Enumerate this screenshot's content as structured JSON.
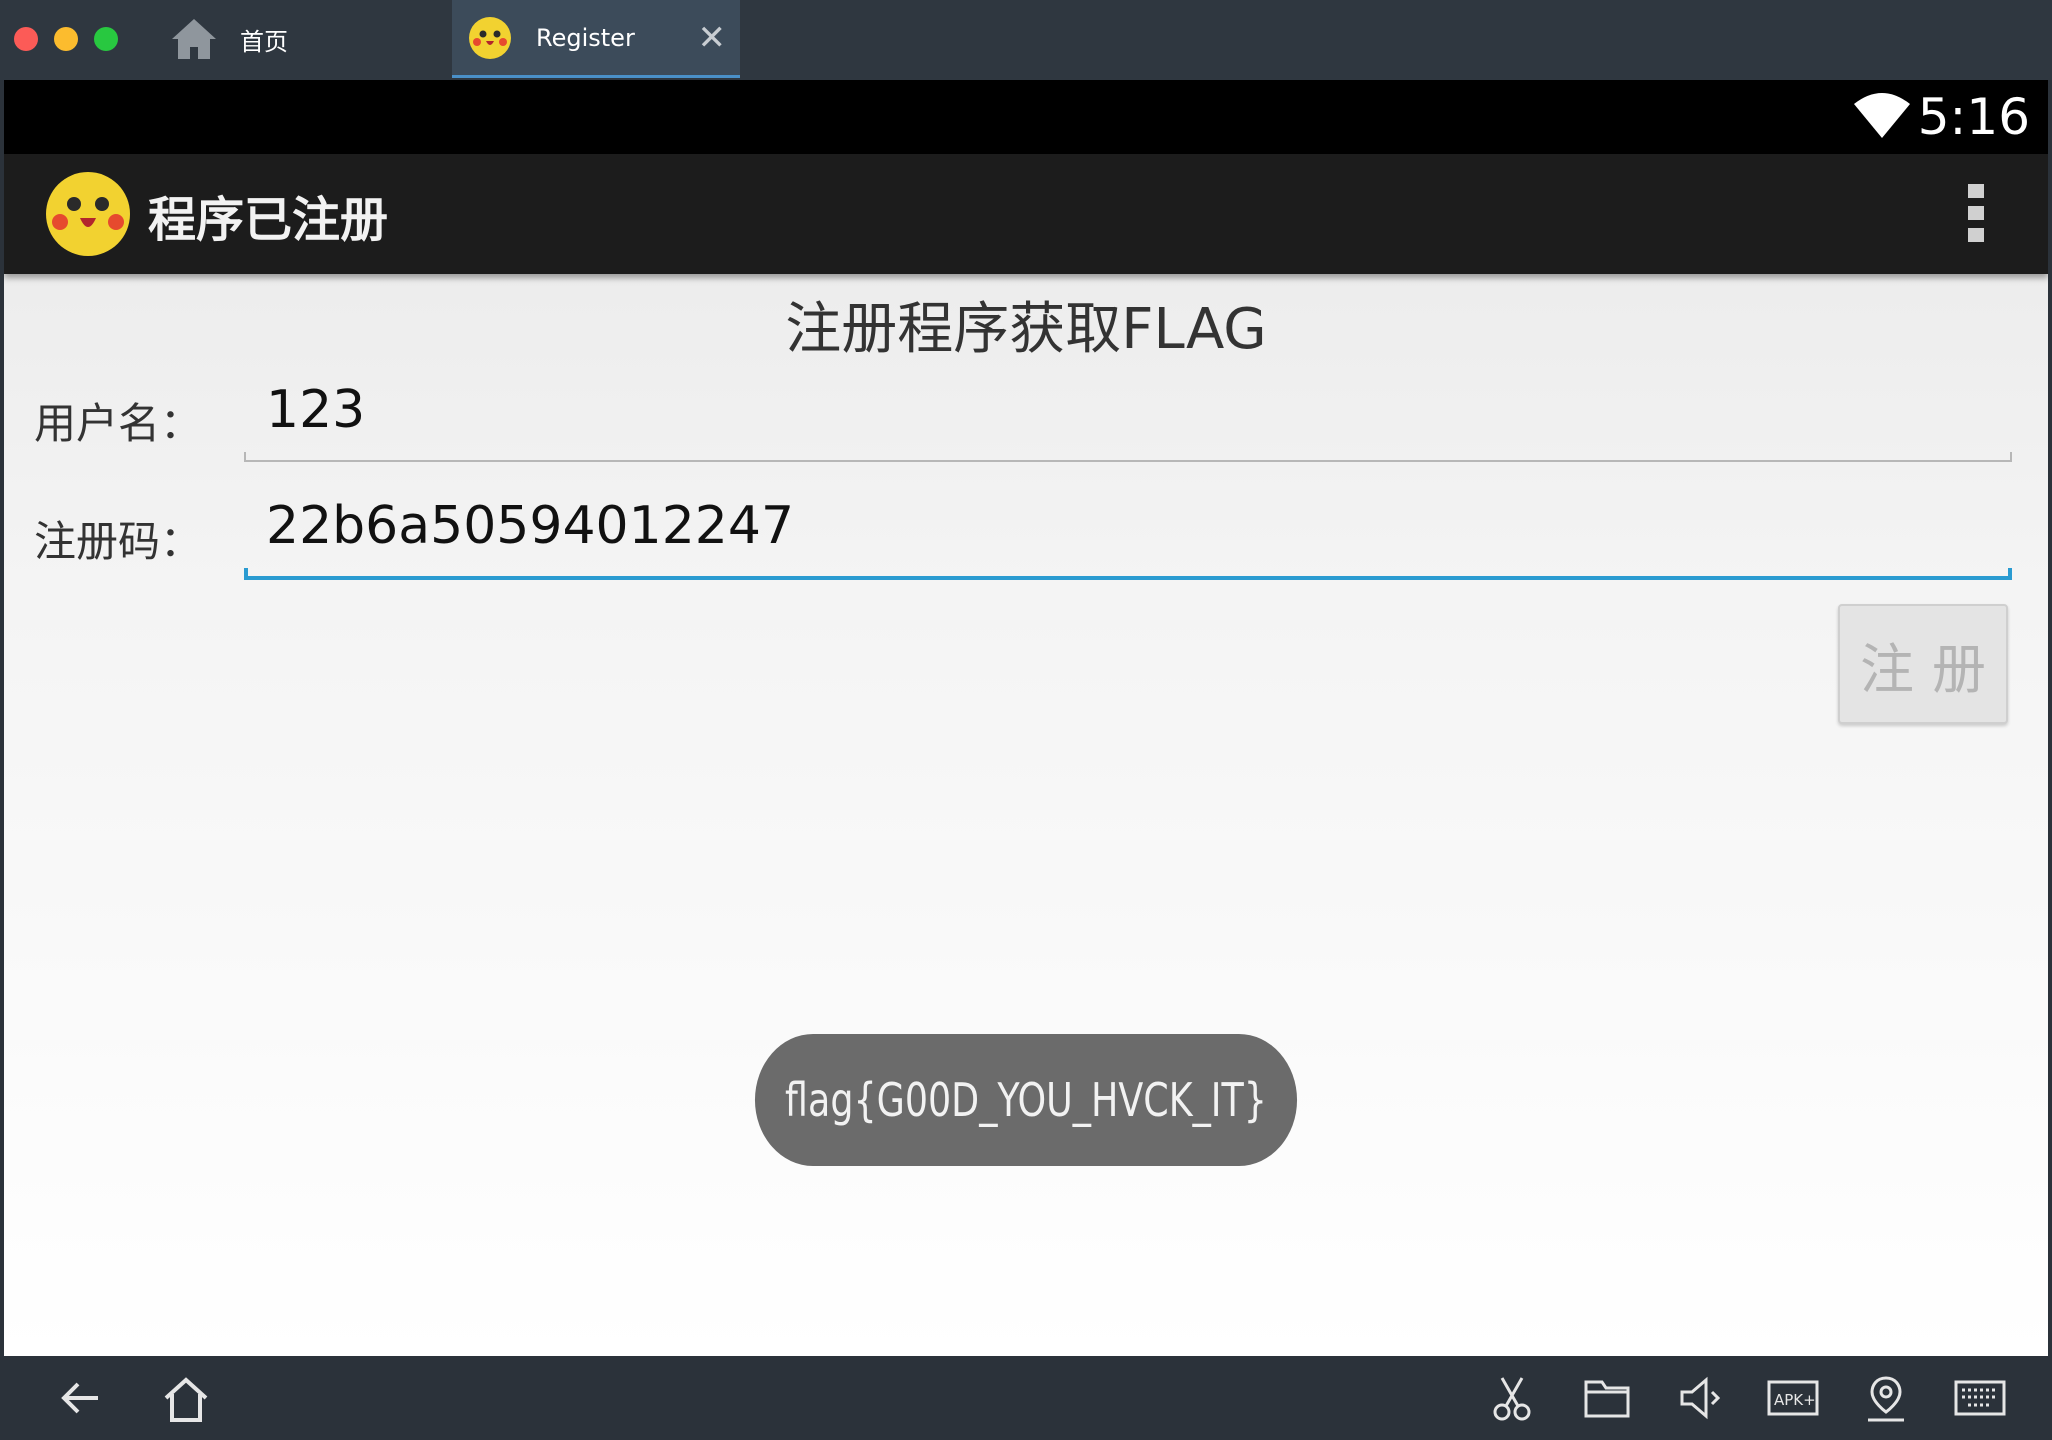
{
  "window": {
    "tabs": [
      {
        "label": "首页",
        "icon": "home-icon"
      },
      {
        "label": "Register",
        "icon": "pikachu-app-icon",
        "close": "✕",
        "active": true
      }
    ]
  },
  "statusbar": {
    "time": "5:16",
    "icons": [
      "wifi-icon"
    ]
  },
  "actionbar": {
    "title": "程序已注册",
    "logo": "pikachu-app-icon",
    "menu": "overflow-menu-icon"
  },
  "form": {
    "heading": "注册程序获取FLAG",
    "username_label": "用户名：",
    "username_value": "123",
    "regcode_label": "注册码：",
    "regcode_value": "22b6a50594012247",
    "register_button": "注册"
  },
  "toast": {
    "text": "flag{G00D_YOU_HVCK_IT}"
  },
  "bottombar": {
    "icons": [
      "back-icon",
      "home-icon",
      "scissors-icon",
      "folder-icon",
      "volume-icon",
      "apk-install-icon",
      "location-icon",
      "keyboard-icon"
    ]
  },
  "colors": {
    "accent": "#2a9bd1",
    "toast_bg": "#6b6b6b",
    "actionbar_bg": "#1c1c1c"
  }
}
